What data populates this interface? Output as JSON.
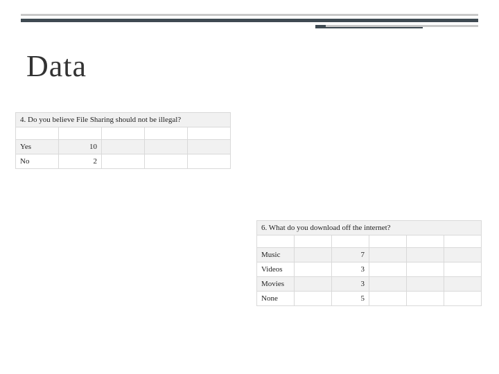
{
  "title": "Data",
  "table1": {
    "question": "4. Do you believe File Sharing should not be illegal?",
    "rows": [
      {
        "label": "Yes",
        "value": "10"
      },
      {
        "label": "No",
        "value": "2"
      }
    ]
  },
  "table2": {
    "question": "6. What do you download off the internet?",
    "rows": [
      {
        "label": "Music",
        "value": "7"
      },
      {
        "label": "Videos",
        "value": "3"
      },
      {
        "label": "Movies",
        "value": "3"
      },
      {
        "label": "None",
        "value": "5"
      }
    ]
  },
  "chart_data": [
    {
      "type": "table",
      "title": "4. Do you believe File Sharing should not be illegal?",
      "categories": [
        "Yes",
        "No"
      ],
      "values": [
        10,
        2
      ]
    },
    {
      "type": "table",
      "title": "6. What do you download off the internet?",
      "categories": [
        "Music",
        "Videos",
        "Movies",
        "None"
      ],
      "values": [
        7,
        3,
        3,
        5
      ]
    }
  ]
}
